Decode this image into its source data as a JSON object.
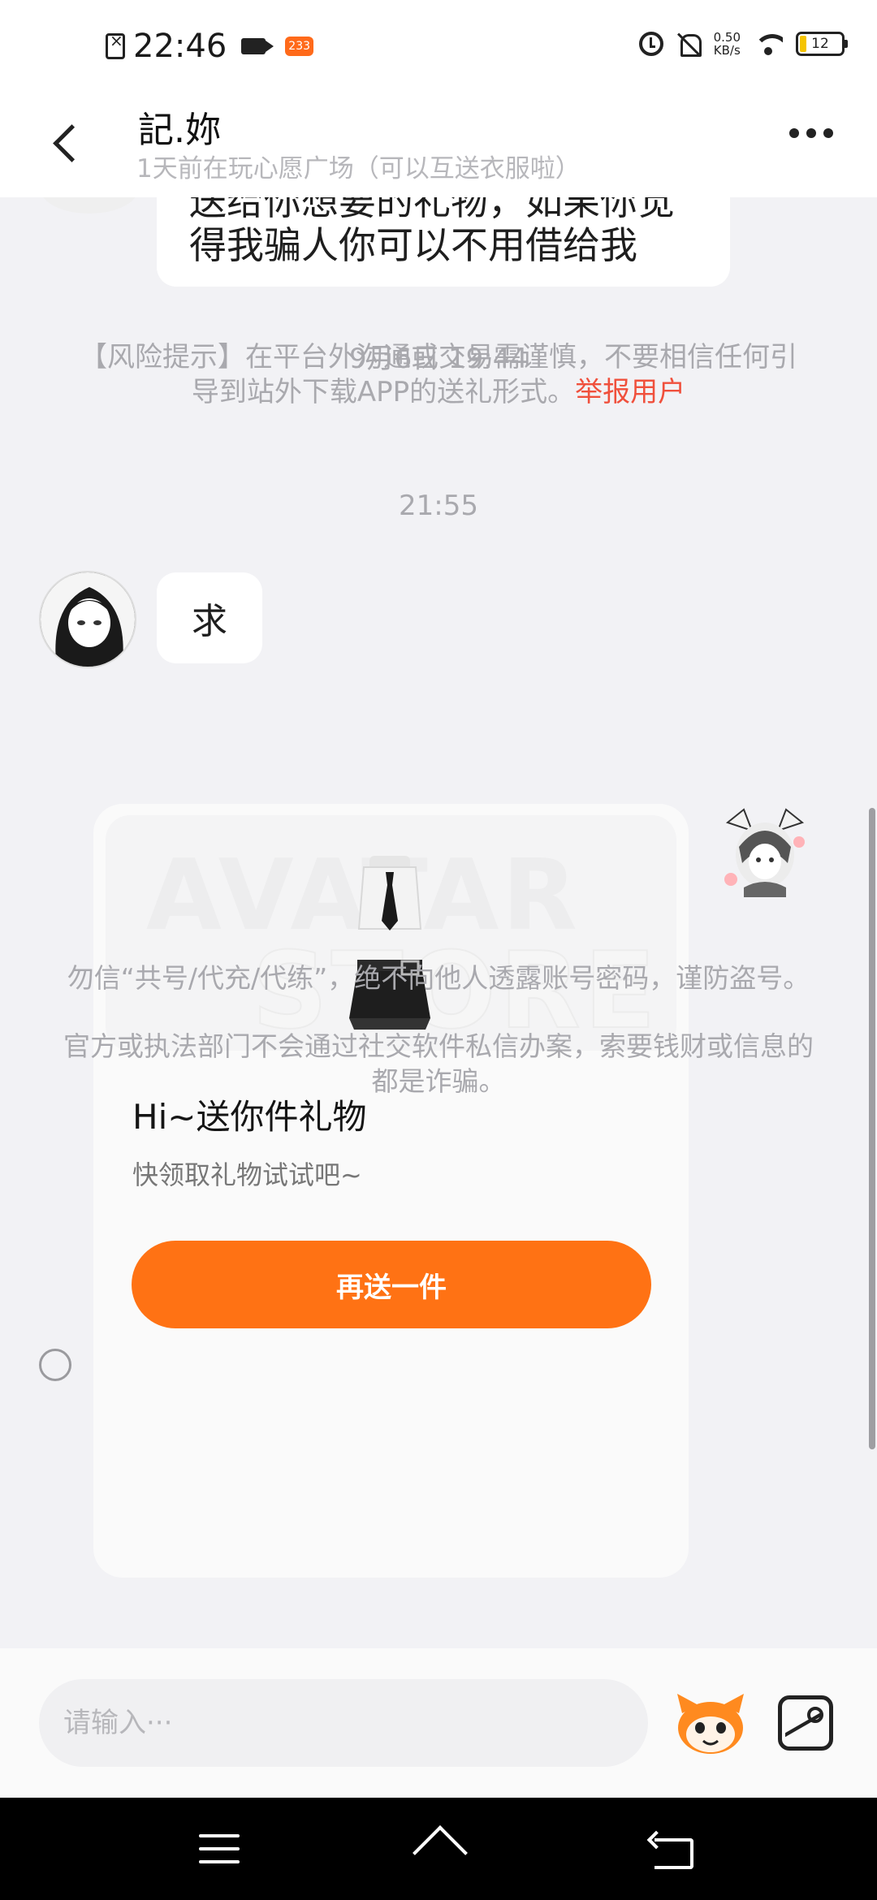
{
  "status_bar": {
    "time": "22:46",
    "app_badge": "233",
    "net_speed_value": "0.50",
    "net_speed_unit": "KB/s",
    "battery": "12"
  },
  "header": {
    "title": "記.妳",
    "subtitle": "1天前在玩心愿广场（可以互送衣服啦）"
  },
  "chat": {
    "prev_message_line1": "送给你想要的礼物，如果你觉",
    "prev_message_line2": "得我骗人你可以不用借给我",
    "risk_tip": "【风险提示】在平台外沟通或交易需谨慎，不要相信任何引导到站外下载APP的送礼形式。",
    "risk_link": "举报用户",
    "timestamp_1": "9月6日 19:44",
    "message_1": "求",
    "timestamp_2": "21:55",
    "gift_card": {
      "watermark_top": "AVATAR",
      "watermark_bottom": "STORE",
      "title": "Hi~送你件礼物",
      "description": "快领取礼物试试吧~",
      "button_label": "再送一件"
    },
    "warning_1": "勿信“共号/代充/代练”，绝不向他人透露账号密码，谨防盗号。",
    "warning_2": "官方或执法部门不会通过社交软件私信办案，索要钱财或信息的都是诈骗。"
  },
  "input_bar": {
    "placeholder": "请输入···"
  },
  "colors": {
    "accent": "#ff7214",
    "link_red": "#f0503c",
    "muted_text": "#a9a9ae"
  },
  "icons": [
    "back-icon",
    "more-icon",
    "mascot-emoji-icon",
    "image-icon",
    "nav-menu-icon",
    "nav-home-icon",
    "nav-back-icon"
  ]
}
